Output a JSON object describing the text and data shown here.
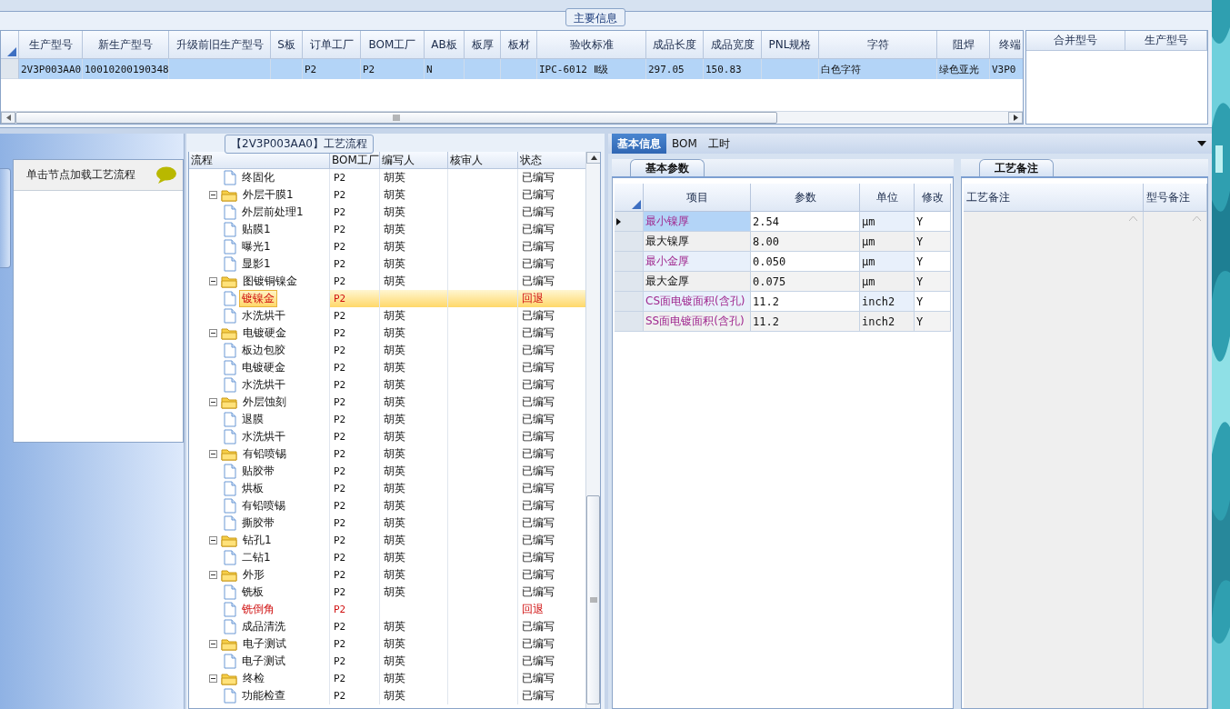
{
  "main_info": {
    "title": "主要信息",
    "columns": [
      "生产型号",
      "新生产型号",
      "升级前旧生产型号",
      "S板",
      "订单工厂",
      "BOM工厂",
      "AB板",
      "板厚",
      "板材",
      "验收标准",
      "成品长度",
      "成品宽度",
      "PNL规格",
      "字符",
      "阻焊",
      "终端"
    ],
    "rows": [
      {
        "selected": true,
        "cells": [
          "2V3P003AA0",
          "10010200190348",
          null,
          null,
          "P2",
          "P2",
          "N",
          null,
          null,
          "IPC-6012 Ⅱ级",
          "297.05",
          "150.83",
          null,
          "白色字符",
          "绿色亚光",
          "V3P0"
        ]
      }
    ],
    "side_columns": [
      "合并型号",
      "生产型号"
    ]
  },
  "left_panel": {
    "hint": "单击节点加载工艺流程"
  },
  "flow": {
    "title": "【2V3P003AA0】工艺流程",
    "columns": [
      "流程",
      "BOM工厂",
      "编写人",
      "核审人",
      "状态"
    ],
    "items": [
      {
        "kind": "file",
        "label": "终固化",
        "bom": "P2",
        "author": "胡英",
        "status": "已编写",
        "selected": false,
        "returned": false
      },
      {
        "kind": "folder",
        "label": "外层干膜1",
        "bom": "P2",
        "author": "胡英",
        "status": "已编写",
        "selected": false,
        "returned": false,
        "expanded": true,
        "children": [
          {
            "kind": "file",
            "label": "外层前处理1",
            "bom": "P2",
            "author": "胡英",
            "status": "已编写",
            "selected": false,
            "returned": false
          },
          {
            "kind": "file",
            "label": "贴膜1",
            "bom": "P2",
            "author": "胡英",
            "status": "已编写",
            "selected": false,
            "returned": false
          },
          {
            "kind": "file",
            "label": "曝光1",
            "bom": "P2",
            "author": "胡英",
            "status": "已编写",
            "selected": false,
            "returned": false
          },
          {
            "kind": "file",
            "label": "显影1",
            "bom": "P2",
            "author": "胡英",
            "status": "已编写",
            "selected": false,
            "returned": false
          }
        ]
      },
      {
        "kind": "folder",
        "label": "图镀铜镍金",
        "bom": "P2",
        "author": "胡英",
        "status": "已编写",
        "selected": false,
        "returned": false,
        "expanded": true,
        "children": [
          {
            "kind": "file",
            "label": "镀镍金",
            "bom": "P2",
            "status": "回退",
            "selected": true,
            "returned": true
          },
          {
            "kind": "file",
            "label": "水洗烘干",
            "bom": "P2",
            "author": "胡英",
            "status": "已编写",
            "selected": false,
            "returned": false
          }
        ]
      },
      {
        "kind": "folder",
        "label": "电镀硬金",
        "bom": "P2",
        "author": "胡英",
        "status": "已编写",
        "selected": false,
        "returned": false,
        "expanded": true,
        "children": [
          {
            "kind": "file",
            "label": "板边包胶",
            "bom": "P2",
            "author": "胡英",
            "status": "已编写",
            "selected": false,
            "returned": false
          },
          {
            "kind": "file",
            "label": "电镀硬金",
            "bom": "P2",
            "author": "胡英",
            "status": "已编写",
            "selected": false,
            "returned": false
          },
          {
            "kind": "file",
            "label": "水洗烘干",
            "bom": "P2",
            "author": "胡英",
            "status": "已编写",
            "selected": false,
            "returned": false
          }
        ]
      },
      {
        "kind": "folder",
        "label": "外层蚀刻",
        "bom": "P2",
        "author": "胡英",
        "status": "已编写",
        "selected": false,
        "returned": false,
        "expanded": true,
        "children": [
          {
            "kind": "file",
            "label": "退膜",
            "bom": "P2",
            "author": "胡英",
            "status": "已编写",
            "selected": false,
            "returned": false
          },
          {
            "kind": "file",
            "label": "水洗烘干",
            "bom": "P2",
            "author": "胡英",
            "status": "已编写",
            "selected": false,
            "returned": false
          }
        ]
      },
      {
        "kind": "folder",
        "label": "有铅喷锡",
        "bom": "P2",
        "author": "胡英",
        "status": "已编写",
        "selected": false,
        "returned": false,
        "expanded": true,
        "children": [
          {
            "kind": "file",
            "label": "贴胶带",
            "bom": "P2",
            "author": "胡英",
            "status": "已编写",
            "selected": false,
            "returned": false
          },
          {
            "kind": "file",
            "label": "烘板",
            "bom": "P2",
            "author": "胡英",
            "status": "已编写",
            "selected": false,
            "returned": false
          },
          {
            "kind": "file",
            "label": "有铅喷锡",
            "bom": "P2",
            "author": "胡英",
            "status": "已编写",
            "selected": false,
            "returned": false
          },
          {
            "kind": "file",
            "label": "撕胶带",
            "bom": "P2",
            "author": "胡英",
            "status": "已编写",
            "selected": false,
            "returned": false
          }
        ]
      },
      {
        "kind": "folder",
        "label": "钻孔1",
        "bom": "P2",
        "author": "胡英",
        "status": "已编写",
        "selected": false,
        "returned": false,
        "expanded": true,
        "children": [
          {
            "kind": "file",
            "label": "二钻1",
            "bom": "P2",
            "author": "胡英",
            "status": "已编写",
            "selected": false,
            "returned": false
          }
        ]
      },
      {
        "kind": "folder",
        "label": "外形",
        "bom": "P2",
        "author": "胡英",
        "status": "已编写",
        "selected": false,
        "returned": false,
        "expanded": true,
        "children": [
          {
            "kind": "file",
            "label": "铣板",
            "bom": "P2",
            "author": "胡英",
            "status": "已编写",
            "selected": false,
            "returned": false
          },
          {
            "kind": "file",
            "label": "铣倒角",
            "bom": "P2",
            "status": "回退",
            "selected": false,
            "returned": true
          },
          {
            "kind": "file",
            "label": "成品清洗",
            "bom": "P2",
            "author": "胡英",
            "status": "已编写",
            "selected": false,
            "returned": false
          }
        ]
      },
      {
        "kind": "folder",
        "label": "电子测试",
        "bom": "P2",
        "author": "胡英",
        "status": "已编写",
        "selected": false,
        "returned": false,
        "expanded": true,
        "children": [
          {
            "kind": "file",
            "label": "电子测试",
            "bom": "P2",
            "author": "胡英",
            "status": "已编写",
            "selected": false,
            "returned": false
          }
        ]
      },
      {
        "kind": "folder",
        "label": "终检",
        "bom": "P2",
        "author": "胡英",
        "status": "已编写",
        "selected": false,
        "returned": false,
        "expanded": true,
        "children": [
          {
            "kind": "file",
            "label": "功能检查",
            "bom": "P2",
            "author": "胡英",
            "status": "已编写",
            "selected": false,
            "returned": false
          }
        ]
      }
    ]
  },
  "detail": {
    "tabs": [
      {
        "label": "基本信息",
        "selected": true
      },
      {
        "label": "BOM",
        "selected": false
      },
      {
        "label": "工时",
        "selected": false
      }
    ],
    "params": {
      "tab": "基本参数",
      "columns": [
        "项目",
        "参数",
        "单位",
        "修改"
      ],
      "rows": [
        {
          "item": "最小镍厚",
          "value": "2.54",
          "unit": "μm",
          "modify": "Y",
          "selected": true,
          "highlighted": true
        },
        {
          "item": "最大镍厚",
          "value": "8.00",
          "unit": "μm",
          "modify": "Y",
          "selected": false,
          "highlighted": false
        },
        {
          "item": "最小金厚",
          "value": "0.050",
          "unit": "μm",
          "modify": "Y",
          "selected": false,
          "highlighted": true
        },
        {
          "item": "最大金厚",
          "value": "0.075",
          "unit": "μm",
          "modify": "Y",
          "selected": false,
          "highlighted": false
        },
        {
          "item": "CS面电镀面积(含孔)",
          "value": "11.2",
          "unit": "inch2",
          "modify": "Y",
          "selected": false,
          "highlighted": true
        },
        {
          "item": "SS面电镀面积(含孔)",
          "value": "11.2",
          "unit": "inch2",
          "modify": "Y",
          "selected": false,
          "highlighted": true
        }
      ]
    },
    "notes": {
      "tab": "工艺备注",
      "columns": [
        "工艺备注",
        "型号备注"
      ]
    }
  }
}
